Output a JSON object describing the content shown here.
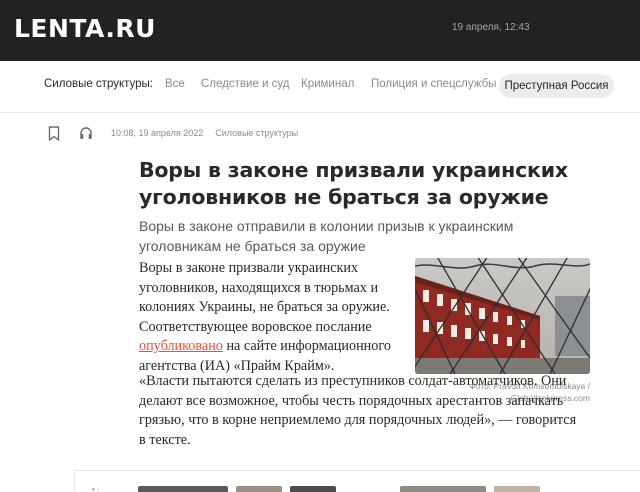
{
  "header": {
    "logo": "LΕNTA.RU",
    "date": "19 апреля, 12:43"
  },
  "rubrics": {
    "title": "Силовые структуры:",
    "items": [
      "Все",
      "Следствие и суд",
      "Криминал",
      "Полиция и спецслужбы"
    ],
    "active": "Преступная Россия"
  },
  "article": {
    "datetime": "10:08, 19 апреля 2022",
    "rubric": "Силовые структуры",
    "title": "Воры в законе призвали украинских уголовников не браться за оружие",
    "lead": "Воры в законе отправили в колонии призыв к украинским уголовникам не браться за оружие",
    "para1_before": "Воры в законе призвали украинских уголовников, находящихся в тюрьмах и колониях Украины, не браться за оружие. Соответствующее воровское послание ",
    "para1_link": "опубликовано",
    "para1_after": " на сайте информационного агентства (ИА) «Прайм Крайм».",
    "para2": "«Власти пытаются сделать из преступников солдат-автоматчиков. Они делают все возможное, чтобы честь порядочных арестантов запачкать грязью, что в корне неприемлемо для порядочных людей», — говорится в тексте.",
    "photo_caption_line1": "Фото: Pravda Komsomolskaya /",
    "photo_caption_line2": "Globallookpress.com"
  },
  "icons": {
    "bookmark": "bookmark-icon",
    "listen": "headphones-icon"
  },
  "colors": {
    "topbar": "#222222",
    "link": "#e8513d",
    "active_pill": "#ececec"
  }
}
